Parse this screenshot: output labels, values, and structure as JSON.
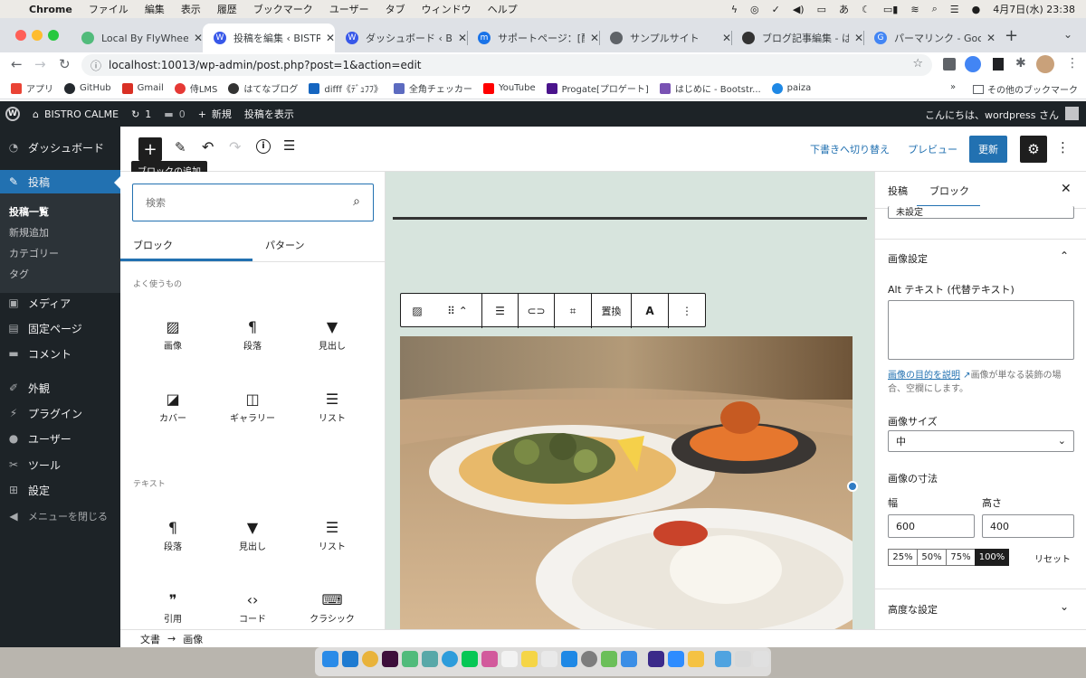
{
  "menubar": {
    "app": "Chrome",
    "items": [
      "ファイル",
      "編集",
      "表示",
      "履歴",
      "ブックマーク",
      "ユーザー",
      "タブ",
      "ウィンドウ",
      "ヘルプ"
    ],
    "datetime": "4月7日(水)  23:38"
  },
  "tabs": [
    {
      "title": "Local By FlyWheelで",
      "color": "#51bb7b"
    },
    {
      "title": "投稿を編集 ‹ BISTRO",
      "color": "#3858e9"
    },
    {
      "title": "ダッシュボード ‹ BIS",
      "color": "#3858e9"
    },
    {
      "title": "サポートページ：[配",
      "color": "#1a73e8"
    },
    {
      "title": "サンプルサイト",
      "color": "#5f6368"
    },
    {
      "title": "ブログ記事編集 - はて",
      "color": "#333333"
    },
    {
      "title": "パーマリンク - Goog",
      "color": "#4285f4"
    }
  ],
  "address": {
    "url": "localhost:10013/wp-admin/post.php?post=1&action=edit"
  },
  "bookmarks": [
    {
      "label": "アプリ",
      "color": "#ea4335"
    },
    {
      "label": "GitHub",
      "color": "#24292e"
    },
    {
      "label": "Gmail",
      "color": "#d93025"
    },
    {
      "label": "侍LMS",
      "color": "#e53935"
    },
    {
      "label": "はてなブログ",
      "color": "#333333"
    },
    {
      "label": "difff《ﾃﾞｭﾌﾌ》",
      "color": "#1565c0"
    },
    {
      "label": "全角チェッカー",
      "color": "#5c6bc0"
    },
    {
      "label": "YouTube",
      "color": "#ff0000"
    },
    {
      "label": "Progate[プロゲート]",
      "color": "#4a148c"
    },
    {
      "label": "はじめに - Bootstr...",
      "color": "#7952b3"
    },
    {
      "label": "paiza",
      "color": "#1e88e5"
    }
  ],
  "bookmarks_other": "その他のブックマーク",
  "adminbar": {
    "site": "BISTRO CALME",
    "updates": "1",
    "comments": "0",
    "new": "新規",
    "view": "投稿を表示",
    "greeting": "こんにちは、wordpress さん"
  },
  "sidebar": {
    "dashboard": "ダッシュボード",
    "posts": "投稿",
    "all_posts": "投稿一覧",
    "add_new": "新規追加",
    "categories": "カテゴリー",
    "tags": "タグ",
    "media": "メディア",
    "pages": "固定ページ",
    "comments": "コメント",
    "appearance": "外観",
    "plugins": "プラグイン",
    "users": "ユーザー",
    "tools": "ツール",
    "settings": "設定",
    "collapse": "メニューを閉じる"
  },
  "toolbar": {
    "tooltip": "ブロックの追加",
    "draft": "下書きへ切り替え",
    "preview": "プレビュー",
    "update": "更新"
  },
  "inserter": {
    "search_placeholder": "検索",
    "tab_blocks": "ブロック",
    "tab_patterns": "パターン",
    "section_common": "よく使うもの",
    "section_text": "テキスト",
    "common": [
      {
        "label": "画像",
        "icon": "image-icon"
      },
      {
        "label": "段落",
        "icon": "paragraph-icon"
      },
      {
        "label": "見出し",
        "icon": "heading-icon"
      },
      {
        "label": "カバー",
        "icon": "cover-icon"
      },
      {
        "label": "ギャラリー",
        "icon": "gallery-icon"
      },
      {
        "label": "リスト",
        "icon": "list-icon"
      }
    ],
    "text": [
      {
        "label": "段落",
        "icon": "paragraph-icon"
      },
      {
        "label": "見出し",
        "icon": "heading-icon"
      },
      {
        "label": "リスト",
        "icon": "list-icon"
      },
      {
        "label": "引用",
        "icon": "quote-icon"
      },
      {
        "label": "コード",
        "icon": "code-icon"
      },
      {
        "label": "クラシック",
        "icon": "classic-icon"
      }
    ]
  },
  "block_toolbar": {
    "replace": "置換",
    "text": "A"
  },
  "settings": {
    "tab_post": "投稿",
    "tab_block": "ブロック",
    "select_value": "未設定",
    "image_settings": "画像設定",
    "alt_label": "Alt テキスト (代替テキスト)",
    "alt_link": "画像の目的を説明",
    "alt_help": "画像が単なる装飾の場合、空欄にします。",
    "size_label": "画像サイズ",
    "size_value": "中",
    "dims_label": "画像の寸法",
    "width_label": "幅",
    "height_label": "高さ",
    "width": "600",
    "height": "400",
    "pcts": [
      "25%",
      "50%",
      "75%",
      "100%"
    ],
    "active_pct": "100%",
    "reset": "リセット",
    "advanced": "高度な設定"
  },
  "breadcrumb": {
    "doc": "文書",
    "arrow": "→",
    "image": "画像"
  },
  "colors": {
    "wp_blue": "#2271b1",
    "admin_dark": "#1d2327",
    "canvas_bg": "#d7e4dd"
  }
}
